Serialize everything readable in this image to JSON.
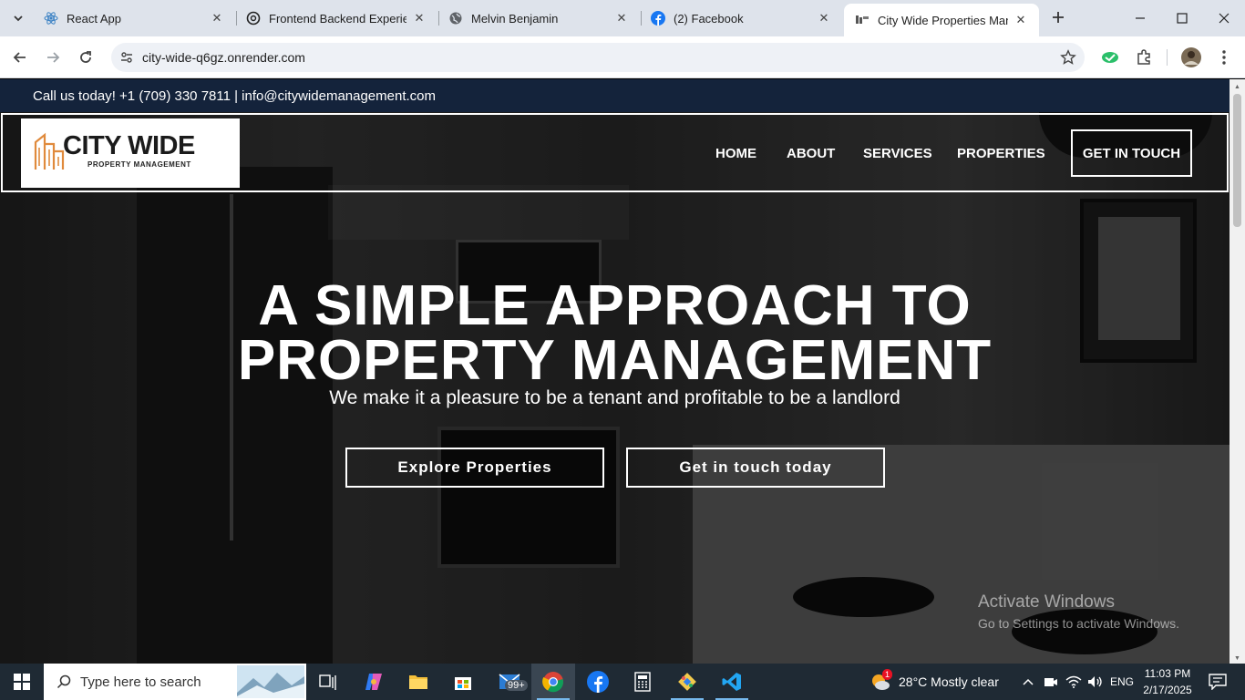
{
  "browser": {
    "tabs": [
      {
        "title": "React App",
        "active": false
      },
      {
        "title": "Frontend Backend Experienc",
        "active": false
      },
      {
        "title": "Melvin Benjamin",
        "active": false
      },
      {
        "title": "(2) Facebook",
        "active": false
      },
      {
        "title": "City Wide Properties Manag",
        "active": true
      }
    ],
    "url": "city-wide-q6gz.onrender.com"
  },
  "page": {
    "topbar_text": "Call us today! +1 (709) 330 7811 | info@citywidemanagement.com",
    "logo": {
      "name": "CITY WIDE",
      "tagline": "PROPERTY MANAGEMENT"
    },
    "nav": {
      "items": [
        "HOME",
        "ABOUT",
        "SERVICES",
        "PROPERTIES"
      ],
      "cta": "GET IN TOUCH"
    },
    "hero": {
      "title_line1": "A SIMPLE APPROACH TO",
      "title_line2": "PROPERTY MANAGEMENT",
      "subtitle": "We make it a pleasure to be a tenant and profitable to be a landlord",
      "primary_button": "Explore Properties",
      "secondary_button": "Get in touch today"
    },
    "watermark": {
      "title": "Activate Windows",
      "subtitle": "Go to Settings to activate Windows."
    }
  },
  "taskbar": {
    "search_placeholder": "Type here to search",
    "mail_badge": "99+",
    "weather": "28°C  Mostly clear",
    "language": "ENG",
    "time": "11:03 PM",
    "date": "2/17/2025",
    "weather_alert": "1"
  },
  "colors": {
    "topbar_bg": "#14233b",
    "logo_accent": "#e08a3c",
    "taskbar_bg": "#1f2a34"
  }
}
